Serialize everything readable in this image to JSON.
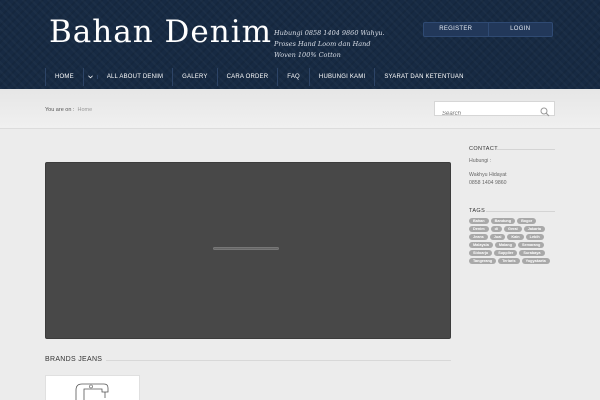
{
  "header": {
    "logo": "Bahan Denim",
    "tagline": "Hubungi 0858 1404 9860 Wahyu. Proses Hand Loom dan Hand Woven 100% Cotton",
    "register_label": "REGISTER",
    "login_label": "LOGIN"
  },
  "nav": {
    "items": [
      "HOME",
      "ALL ABOUT DENIM",
      "GALERY",
      "CARA ORDER",
      "FAQ",
      "HUBUNGI KAMI",
      "SYARAT DAN KETENTUAN"
    ],
    "chevron_icon": "chevron-down-icon"
  },
  "breadcrumb": {
    "prefix": "You are on :",
    "current": "Home"
  },
  "search": {
    "placeholder": "Search",
    "icon": "search-icon"
  },
  "main": {
    "brands_title": "BRANDS JEANS"
  },
  "sidebar": {
    "contact": {
      "title": "CONTACT",
      "line1": "Hubungi :",
      "name": "Wakhyu Hidayat",
      "phone": "0858 1404 9860"
    },
    "tags": {
      "title": "TAGS",
      "items": [
        "Bahan",
        "Bandung",
        "Bogor",
        "Denim",
        "di",
        "Gerai",
        "Jakarta",
        "Jeans",
        "Jual",
        "Kain",
        "Lebih",
        "Malaysia",
        "Malang",
        "Semarang",
        "Sidoarjo",
        "Supplier",
        "Surabaya",
        "Tangerang",
        "Terlaris",
        "Yogyakarta"
      ]
    }
  }
}
